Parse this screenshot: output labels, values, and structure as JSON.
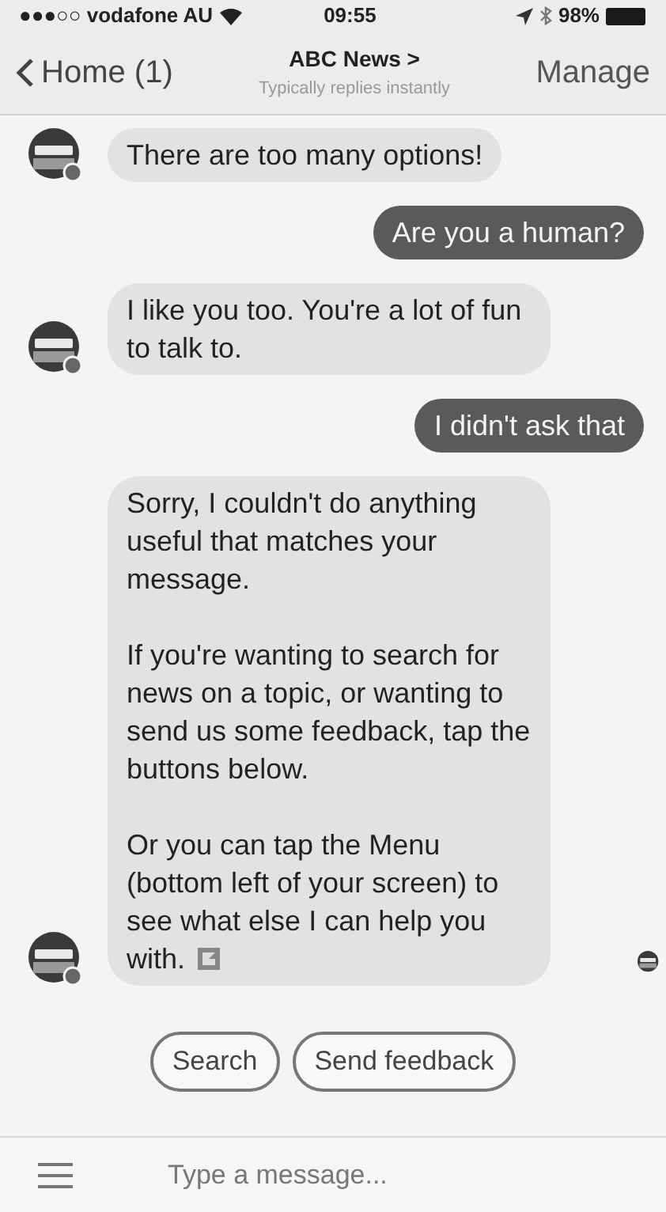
{
  "status_bar": {
    "carrier": "●●●○○ vodafone AU",
    "time": "09:55",
    "battery": "98%"
  },
  "nav": {
    "back": "Home (1)",
    "title": "ABC News >",
    "subtitle": "Typically replies instantly",
    "action": "Manage"
  },
  "messages": [
    {
      "kind": "bot",
      "paragraphs": [
        "There are too many options!"
      ],
      "attachment_icon": false
    },
    {
      "kind": "user",
      "paragraphs": [
        "Are you a human?"
      ],
      "attachment_icon": false
    },
    {
      "kind": "bot",
      "paragraphs": [
        "I like you too. You're a lot of fun to talk to."
      ],
      "attachment_icon": false
    },
    {
      "kind": "user",
      "paragraphs": [
        "I didn't ask that"
      ],
      "attachment_icon": false
    },
    {
      "kind": "bot",
      "paragraphs": [
        "Sorry, I couldn't do anything useful that matches your message.",
        "If you're wanting to search for news on a topic, or wanting to send us some feedback, tap the buttons below.",
        "Or you can tap the Menu (bottom left of your screen) to see what else I can help you with."
      ],
      "attachment_icon": true
    }
  ],
  "read_receipt": true,
  "quick_replies": [
    "Search",
    "Send feedback"
  ],
  "composer": {
    "placeholder": "Type a message..."
  }
}
